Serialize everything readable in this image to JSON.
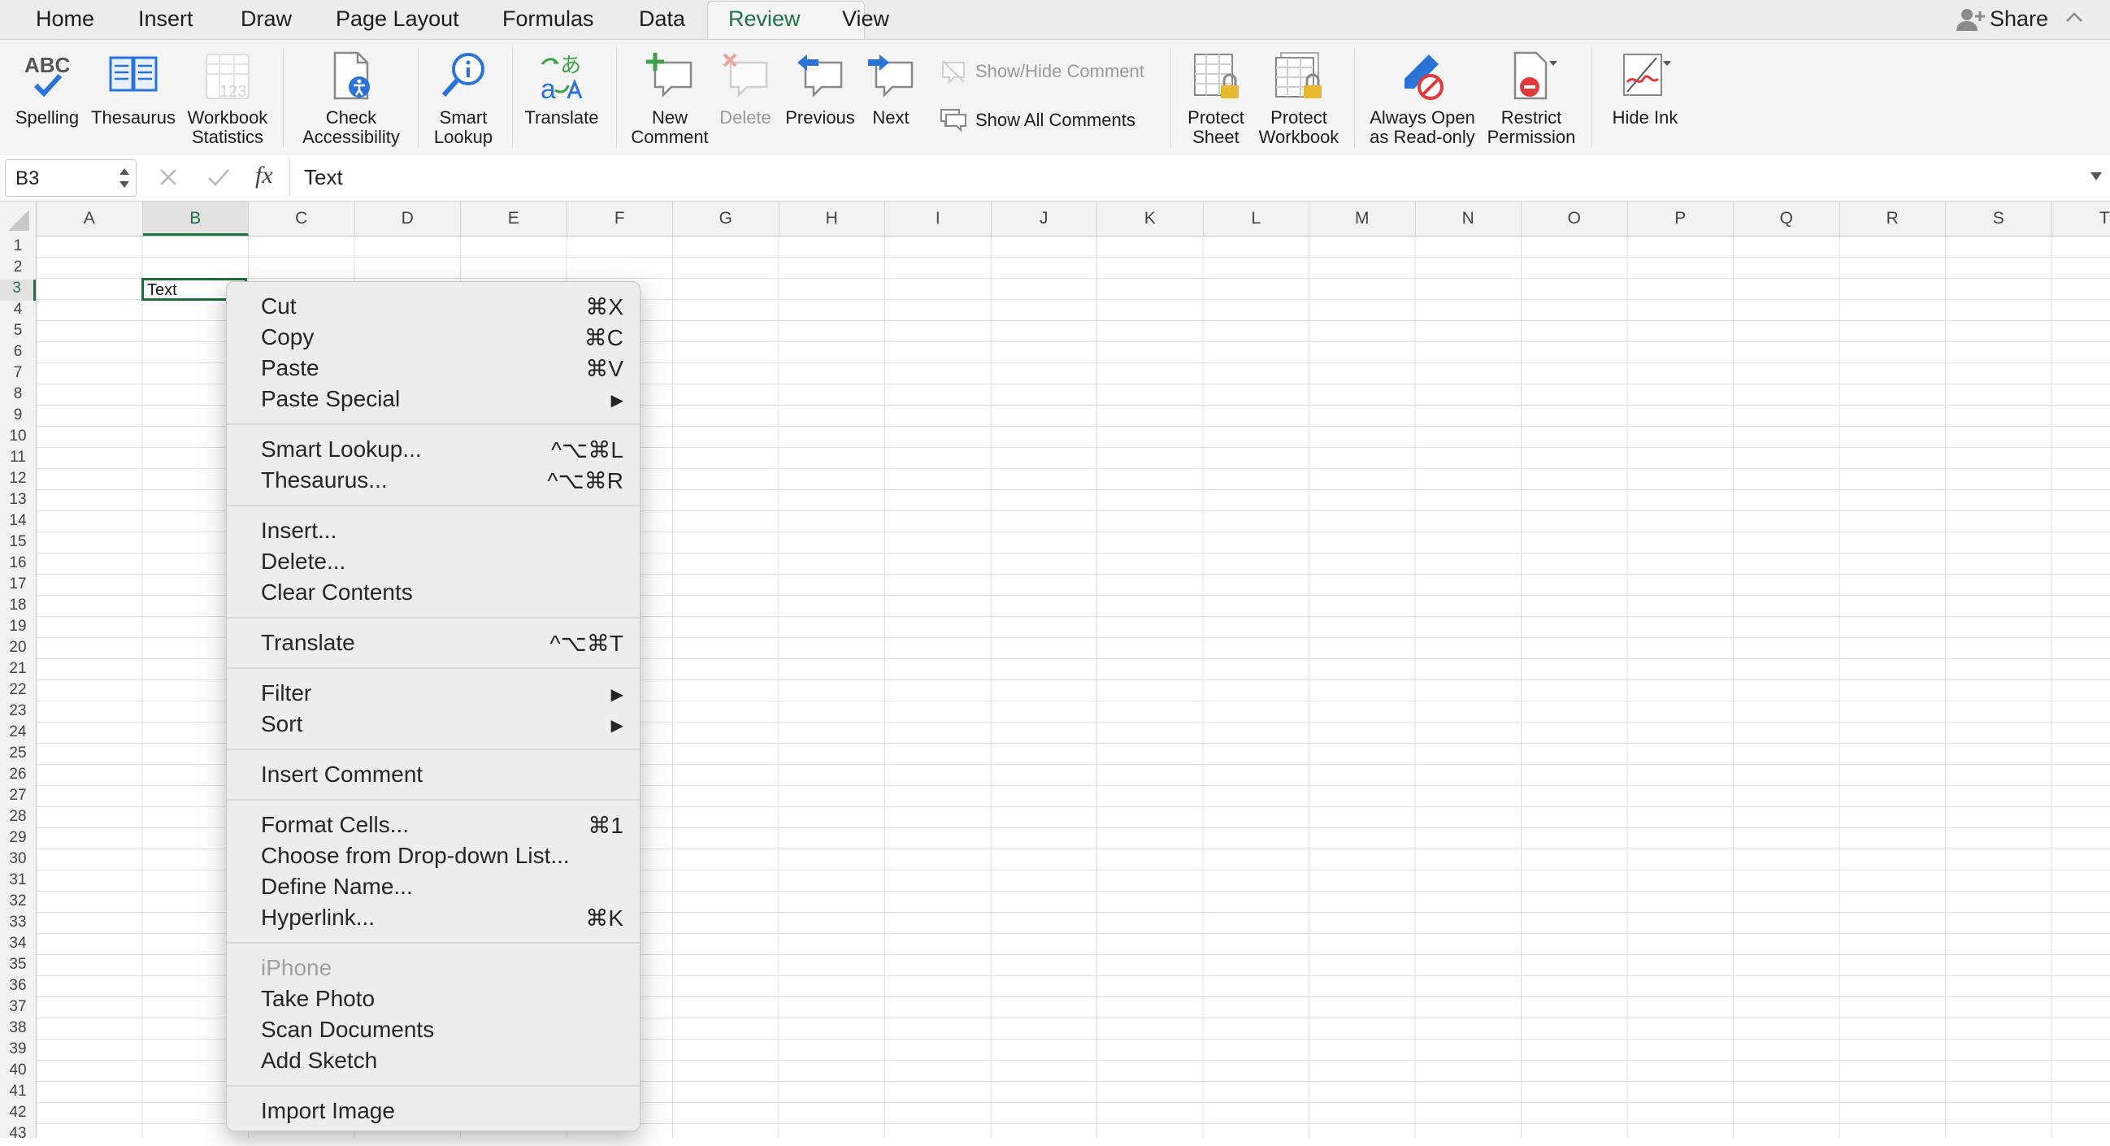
{
  "tabs": [
    "Home",
    "Insert",
    "Draw",
    "Page Layout",
    "Formulas",
    "Data",
    "Review",
    "View"
  ],
  "active_tab": "Review",
  "share_label": "Share",
  "ribbon": {
    "spelling": "Spelling",
    "thesaurus": "Thesaurus",
    "workbook_stats": [
      "Workbook",
      "Statistics"
    ],
    "check_access": [
      "Check",
      "Accessibility"
    ],
    "smart_lookup": [
      "Smart",
      "Lookup"
    ],
    "translate": "Translate",
    "new_comment": [
      "New",
      "Comment"
    ],
    "delete": "Delete",
    "previous": "Previous",
    "next": "Next",
    "show_hide_comment": "Show/Hide Comment",
    "show_all_comments": "Show All Comments",
    "protect_sheet": [
      "Protect",
      "Sheet"
    ],
    "protect_workbook": [
      "Protect",
      "Workbook"
    ],
    "always_open": [
      "Always Open",
      "as Read-only"
    ],
    "restrict": [
      "Restrict",
      "Permission"
    ],
    "hide_ink": "Hide Ink",
    "abc": "ABC"
  },
  "formula_bar": {
    "cell_ref": "B3",
    "fx": "fx",
    "value": "Text"
  },
  "columns": [
    "A",
    "B",
    "C",
    "D",
    "E",
    "F",
    "G",
    "H",
    "I",
    "J",
    "K",
    "L",
    "M",
    "N",
    "O",
    "P",
    "Q",
    "R",
    "S",
    "T"
  ],
  "rows": [
    "1",
    "2",
    "3",
    "4",
    "5",
    "6",
    "7",
    "8",
    "9",
    "10",
    "11",
    "12",
    "13",
    "14",
    "15",
    "16",
    "17",
    "18",
    "19",
    "20",
    "21",
    "22",
    "23",
    "24",
    "25",
    "26",
    "27",
    "28",
    "29",
    "30",
    "31",
    "32",
    "33",
    "34",
    "35",
    "36",
    "37",
    "38",
    "39",
    "40",
    "41",
    "42",
    "43"
  ],
  "cell_b3": "Text",
  "menu_groups": [
    [
      {
        "label": "Cut",
        "shortcut": "⌘X"
      },
      {
        "label": "Copy",
        "shortcut": "⌘C"
      },
      {
        "label": "Paste",
        "shortcut": "⌘V"
      },
      {
        "label": "Paste Special",
        "shortcut": "▶"
      }
    ],
    [
      {
        "label": "Smart Lookup...",
        "shortcut": "^⌥⌘L"
      },
      {
        "label": "Thesaurus...",
        "shortcut": "^⌥⌘R"
      }
    ],
    [
      {
        "label": "Insert...",
        "shortcut": ""
      },
      {
        "label": "Delete...",
        "shortcut": ""
      },
      {
        "label": "Clear Contents",
        "shortcut": ""
      }
    ],
    [
      {
        "label": "Translate",
        "shortcut": "^⌥⌘T"
      }
    ],
    [
      {
        "label": "Filter",
        "shortcut": "▶"
      },
      {
        "label": "Sort",
        "shortcut": "▶"
      }
    ],
    [
      {
        "label": "Insert Comment",
        "shortcut": ""
      }
    ],
    [
      {
        "label": "Format Cells...",
        "shortcut": "⌘1"
      },
      {
        "label": "Choose from Drop-down List...",
        "shortcut": ""
      },
      {
        "label": "Define Name...",
        "shortcut": ""
      },
      {
        "label": "Hyperlink...",
        "shortcut": "⌘K"
      }
    ],
    [
      {
        "label": "iPhone",
        "shortcut": "",
        "disabled": true
      },
      {
        "label": "Take Photo",
        "shortcut": ""
      },
      {
        "label": "Scan Documents",
        "shortcut": ""
      },
      {
        "label": "Add Sketch",
        "shortcut": ""
      }
    ],
    [
      {
        "label": "Import Image",
        "shortcut": ""
      }
    ]
  ],
  "colors": {
    "accent_green": "#217346",
    "selected_border": "#1e6b3c",
    "menu_bg": "#ededed"
  }
}
